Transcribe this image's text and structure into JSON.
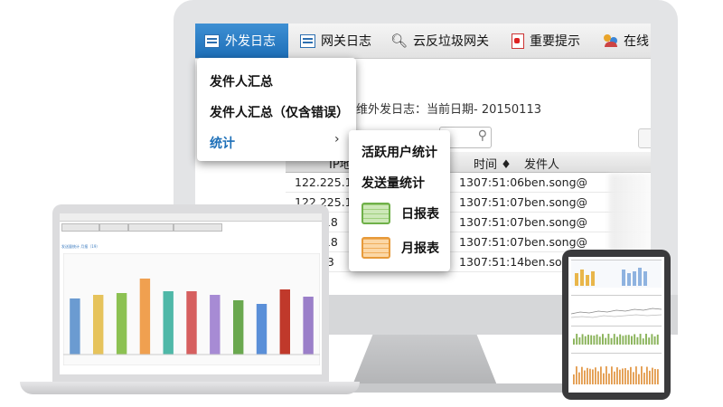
{
  "menubar": {
    "items": [
      {
        "label": "外发日志",
        "icon": "log-icon",
        "active": true
      },
      {
        "label": "网关日志",
        "icon": "log-icon"
      },
      {
        "label": "云反垃圾网关",
        "icon": "search-icon"
      },
      {
        "label": "重要提示",
        "icon": "pdf-icon"
      },
      {
        "label": "在线",
        "icon": "users-icon"
      }
    ]
  },
  "content": {
    "header_text": "维外发日志：当前日期- 20150113"
  },
  "dropdown": {
    "items": [
      "发件人汇总",
      "发件人汇总（仅含错误）",
      "统计"
    ],
    "submenu_arrow": "›"
  },
  "submenu": {
    "items": [
      "活跃用户统计",
      "发送量统计"
    ],
    "daily_label": "日报表",
    "monthly_label": "月报表",
    "colors": {
      "daily": "#6fb049",
      "monthly": "#e79a3a"
    }
  },
  "table": {
    "headers": {
      "ip": "IP地址",
      "time": "时间 ♦",
      "sender": "发件人"
    },
    "rows": [
      {
        "ip": "122.225.18",
        "date_tail": "13",
        "time": "07:51:06",
        "sender": "ben.song@"
      },
      {
        "ip": "122.225.18",
        "date_tail": "13",
        "time": "07:51:07",
        "sender": "ben.song@"
      },
      {
        "ip": "5.18",
        "date_tail": "13",
        "time": "07:51:07",
        "sender": "ben.song@"
      },
      {
        "ip": "5.18",
        "date_tail": "13",
        "time": "07:51:07",
        "sender": "ben.song@"
      },
      {
        "ip": "193",
        "date_tail": "13",
        "time": "07:51:14",
        "sender": "ben.song@"
      }
    ]
  },
  "laptop": {
    "title": "发送量统计 月报（19）",
    "bar_colors": [
      "#6b9bd1",
      "#e6c35c",
      "#8cc152",
      "#f0a050",
      "#4fb8a8",
      "#d65f5f",
      "#a78bd4",
      "#6aa84f",
      "#5a8fd8",
      "#c0392b",
      "#9b7fc9"
    ],
    "bar_values": [
      62,
      66,
      68,
      84,
      70,
      70,
      66,
      60,
      56,
      72,
      64
    ]
  },
  "tablet": {
    "panels": [
      "summary-panel",
      "line-chart-panel",
      "bar-chart-panel",
      "orange-bar-panel"
    ]
  }
}
